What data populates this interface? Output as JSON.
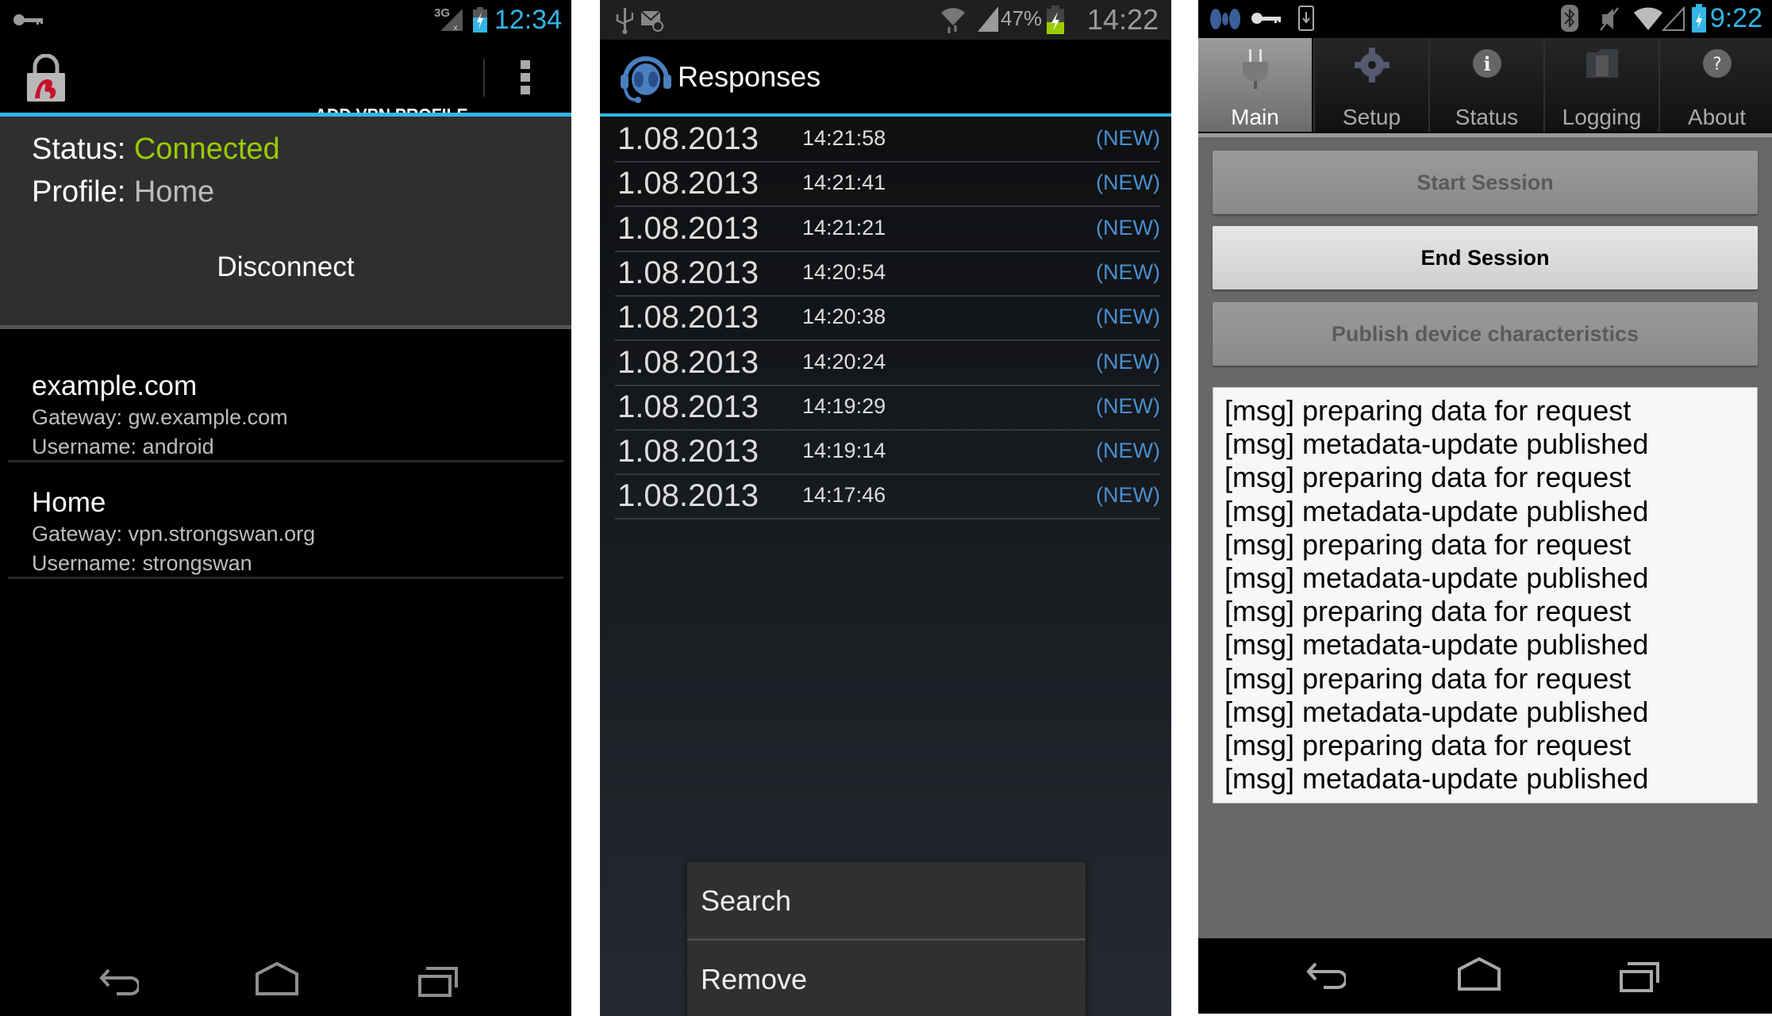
{
  "panel1": {
    "statusbar": {
      "time": "12:34",
      "network_label": "3G",
      "icons": [
        "key-icon",
        "signal-3g-icon",
        "battery-charging-icon"
      ]
    },
    "actionbar": {
      "add_button": "ADD VPN PROFILE",
      "overflow_icon": "overflow-menu-icon",
      "app_icon": "strongswan-lock-icon"
    },
    "status": {
      "status_label": "Status: ",
      "status_value": "Connected",
      "profile_label": "Profile: ",
      "profile_value": "Home",
      "disconnect_label": "Disconnect"
    },
    "profiles": [
      {
        "name": "example.com",
        "gateway": "Gateway: gw.example.com",
        "username": "Username: android"
      },
      {
        "name": "Home",
        "gateway": "Gateway: vpn.strongswan.org",
        "username": "Username: strongswan"
      }
    ],
    "colors": {
      "accent": "#33b5e5",
      "connected": "#99cc00"
    }
  },
  "panel2": {
    "statusbar": {
      "time": "14:22",
      "battery_percent": "47%",
      "icons": [
        "usb-icon",
        "email-icon",
        "wifi-icon",
        "signal-icon",
        "battery-charging-icon"
      ]
    },
    "title": "Responses",
    "responses": [
      {
        "date": "1.08.2013",
        "time": "14:21:58",
        "badge": "(NEW)"
      },
      {
        "date": "1.08.2013",
        "time": "14:21:41",
        "badge": "(NEW)"
      },
      {
        "date": "1.08.2013",
        "time": "14:21:21",
        "badge": "(NEW)"
      },
      {
        "date": "1.08.2013",
        "time": "14:20:54",
        "badge": "(NEW)"
      },
      {
        "date": "1.08.2013",
        "time": "14:20:38",
        "badge": "(NEW)"
      },
      {
        "date": "1.08.2013",
        "time": "14:20:24",
        "badge": "(NEW)"
      },
      {
        "date": "1.08.2013",
        "time": "14:19:29",
        "badge": "(NEW)"
      },
      {
        "date": "1.08.2013",
        "time": "14:19:14",
        "badge": "(NEW)"
      },
      {
        "date": "1.08.2013",
        "time": "14:17:46",
        "badge": "(NEW)"
      }
    ],
    "context_menu": [
      "Search",
      "Remove"
    ],
    "colors": {
      "badge": "#4a8fd0",
      "accent": "#33b5e5"
    }
  },
  "panel3": {
    "statusbar": {
      "time": "9:22",
      "icons": [
        "app-icon",
        "key-icon",
        "download-icon",
        "bluetooth-icon",
        "mute-icon",
        "wifi-icon",
        "signal-icon",
        "battery-charging-icon"
      ]
    },
    "tabs": [
      {
        "label": "Main",
        "icon": "plug-icon",
        "active": true
      },
      {
        "label": "Setup",
        "icon": "gear-icon",
        "active": false
      },
      {
        "label": "Status",
        "icon": "info-icon",
        "active": false
      },
      {
        "label": "Logging",
        "icon": "folder-icon",
        "active": false
      },
      {
        "label": "About",
        "icon": "help-icon",
        "active": false
      }
    ],
    "buttons": [
      {
        "label": "Start Session",
        "enabled": false
      },
      {
        "label": "End Session",
        "enabled": true
      },
      {
        "label": "Publish device characteristics",
        "enabled": false
      }
    ],
    "log": [
      "[msg] preparing data for request",
      "[msg] metadata-update published",
      "[msg] preparing data for request",
      "[msg] metadata-update published",
      "[msg] preparing data for request",
      "[msg] metadata-update published",
      "[msg] preparing data for request",
      "[msg] metadata-update published",
      "[msg] preparing data for request",
      "[msg] metadata-update published",
      "[msg] preparing data for request",
      "[msg] metadata-update published"
    ]
  },
  "navbar": {
    "back": "back-icon",
    "home": "home-icon",
    "recents": "recent-apps-icon"
  }
}
